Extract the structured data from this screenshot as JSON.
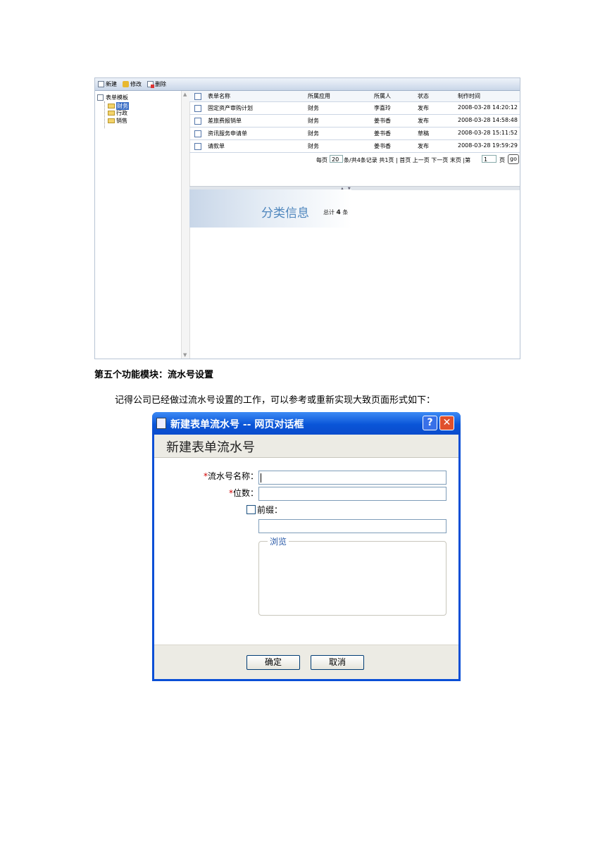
{
  "screenshot1": {
    "toolbar": {
      "new": "新建",
      "edit": "修改",
      "delete": "删除"
    },
    "tree": {
      "root": "表单模板",
      "children": [
        "财务",
        "行政",
        "销售"
      ],
      "selected": "财务"
    },
    "table": {
      "headers": [
        "表单名称",
        "所属应用",
        "所属人",
        "状态",
        "制作时间"
      ],
      "rows": [
        [
          "固定资产审购计划",
          "财务",
          "李喜玲",
          "发布",
          "2008-03-28 14:20:12"
        ],
        [
          "差旅费报销单",
          "财务",
          "姜书香",
          "发布",
          "2008-03-28 14:58:48"
        ],
        [
          "资讯服务申请单",
          "财务",
          "姜书香",
          "草稿",
          "2008-03-28 15:11:52"
        ],
        [
          "请款单",
          "财务",
          "姜书香",
          "发布",
          "2008-03-28 19:59:29"
        ]
      ]
    },
    "pager": {
      "per_page_prefix": "每页",
      "per_page_value": "20",
      "summary": "条/共4条记录  共1页  | 首页  上一页  下一页  末页  |第",
      "page_value": "1",
      "page_suffix": "页",
      "go": "go"
    },
    "banner": {
      "title": "分类信息",
      "total_prefix": "总计",
      "total_value": "4",
      "total_suffix": "条"
    }
  },
  "module_heading": "第五个功能模块：流水号设置",
  "paragraph": "记得公司已经做过流水号设置的工作，可以参考或重新实现大致页面形式如下：",
  "dialog": {
    "window_title": "新建表单流水号  --  网页对话框",
    "help": "?",
    "close": "✕",
    "heading": "新建表单流水号",
    "required_mark": "*",
    "name_label": "流水号名称：",
    "name_value": "",
    "digits_label": "位数：",
    "digits_value": "",
    "prefix_label": "前缀：",
    "prefix_value": "",
    "browse_legend": "浏览",
    "ok": "确定",
    "cancel": "取消"
  }
}
